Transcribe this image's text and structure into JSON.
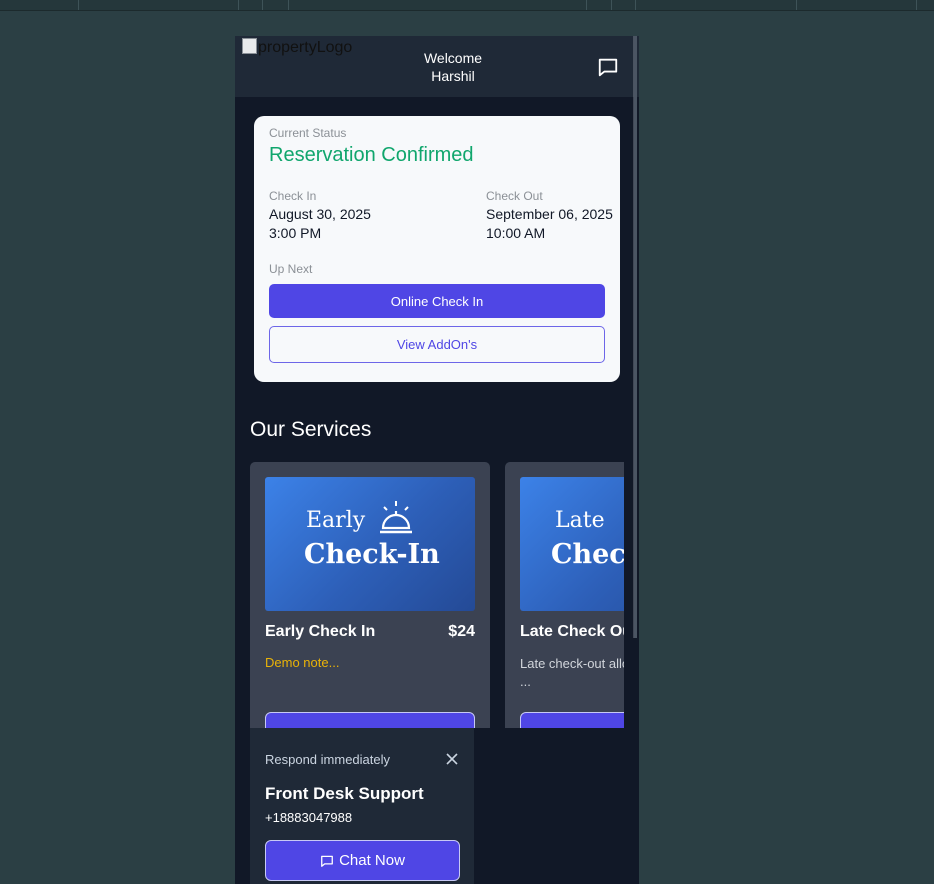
{
  "header": {
    "logo_alt": "propertyLogo",
    "welcome_line1": "Welcome",
    "welcome_line2": "Harshil",
    "chat_icon": "message-square-icon"
  },
  "status": {
    "label": "Current Status",
    "value": "Reservation Confirmed",
    "check_in": {
      "label": "Check In",
      "date": "August 30, 2025",
      "time": "3:00 PM"
    },
    "check_out": {
      "label": "Check Out",
      "date": "September 06, 2025",
      "time": "10:00 AM"
    },
    "up_next_label": "Up Next",
    "primary_button": "Online Check In",
    "secondary_button": "View AddOn's"
  },
  "services": {
    "title": "Our Services",
    "items": [
      {
        "image_line1": "Early",
        "image_line2": "Check-In",
        "name": "Early Check In",
        "price": "$24",
        "note": "Demo note..."
      },
      {
        "image_line1": "Late",
        "image_line2": "Check",
        "name": "Late Check Ou",
        "description": "Late check-out allo extend their stay ..."
      }
    ]
  },
  "support": {
    "subtitle": "Respond immediately",
    "title": "Front Desk Support",
    "phone": "+18883047988",
    "button": "Chat Now"
  },
  "colors": {
    "accent": "#4f46e5",
    "success": "#10a66d",
    "note": "#eab308",
    "background": "#111827"
  }
}
